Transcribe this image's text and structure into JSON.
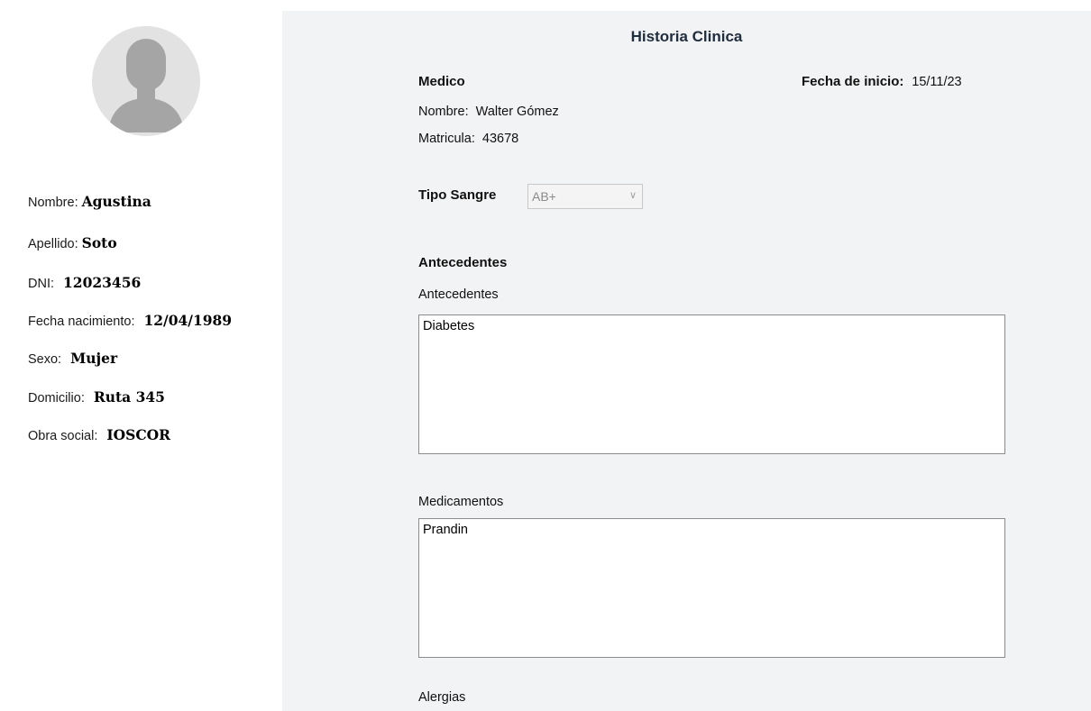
{
  "patient": {
    "fields": [
      {
        "label": "Nombre:",
        "value": "Agustina"
      },
      {
        "label": "Apellido:",
        "value": "Soto"
      },
      {
        "label": "DNI:",
        "value": "12023456"
      },
      {
        "label": "Fecha nacimiento:",
        "value": "12/04/1989"
      },
      {
        "label": "Sexo:",
        "value": "Mujer"
      },
      {
        "label": "Domicilio:",
        "value": "Ruta 345"
      },
      {
        "label": "Obra social:",
        "value": "IOSCOR"
      }
    ]
  },
  "history": {
    "title": "Historia Clinica",
    "medico_heading": "Medico",
    "nombre_label": "Nombre:",
    "nombre_value": "Walter Gómez",
    "matricula_label": "Matricula:",
    "matricula_value": "43678",
    "fecha_label": "Fecha de inicio:",
    "fecha_value": "15/11/23",
    "tipo_sangre_label": "Tipo Sangre",
    "tipo_sangre_value": "AB+",
    "antecedentes_heading": "Antecedentes",
    "antecedentes_label": "Antecedentes",
    "antecedentes_value": "Diabetes",
    "medicamentos_label": "Medicamentos",
    "medicamentos_value": "Prandin",
    "alergias_label": "Alergias"
  },
  "icons": {
    "avatar": "user-avatar-icon",
    "dropdown": "chevron-down-icon"
  },
  "colors": {
    "panel_bg": "#f2f3f5",
    "avatar_bg": "#e2e2e2",
    "avatar_fg": "#a5a5a5"
  }
}
